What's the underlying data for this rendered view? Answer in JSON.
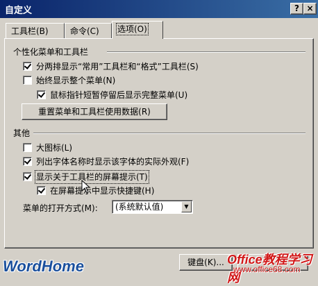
{
  "window": {
    "title": "自定义",
    "help_glyph": "?",
    "close_glyph": "×"
  },
  "tabs": [
    {
      "label": "工具栏(B)"
    },
    {
      "label": "命令(C)"
    },
    {
      "label": "选项(O)",
      "active": true
    }
  ],
  "personalized": {
    "heading": "个性化菜单和工具栏",
    "options": [
      {
        "label": "分两排显示“常用”工具栏和“格式”工具栏(S)",
        "checked": true
      },
      {
        "label": "始终显示整个菜单(N)",
        "checked": false
      },
      {
        "label": "鼠标指针短暂停留后显示完整菜单(U)",
        "checked": true
      }
    ],
    "reset_button": "重置菜单和工具栏使用数据(R)"
  },
  "other": {
    "heading": "其他",
    "options": [
      {
        "label": "大图标(L)",
        "checked": false
      },
      {
        "label": "列出字体名称时显示该字体的实际外观(F)",
        "checked": true
      },
      {
        "label": "显示关于工具栏的屏幕提示(T)",
        "checked": true
      },
      {
        "label": "在屏幕提示中显示快捷键(H)",
        "checked": true
      }
    ],
    "menu_animation_label": "菜单的打开方式(M):",
    "menu_animation_value": "(系统默认值)"
  },
  "footer": {
    "keyboard_button": "键盘(K)..."
  },
  "watermarks": {
    "logo": "WordHome",
    "brand": "Office教程学习网",
    "url": "www.office68.com"
  }
}
